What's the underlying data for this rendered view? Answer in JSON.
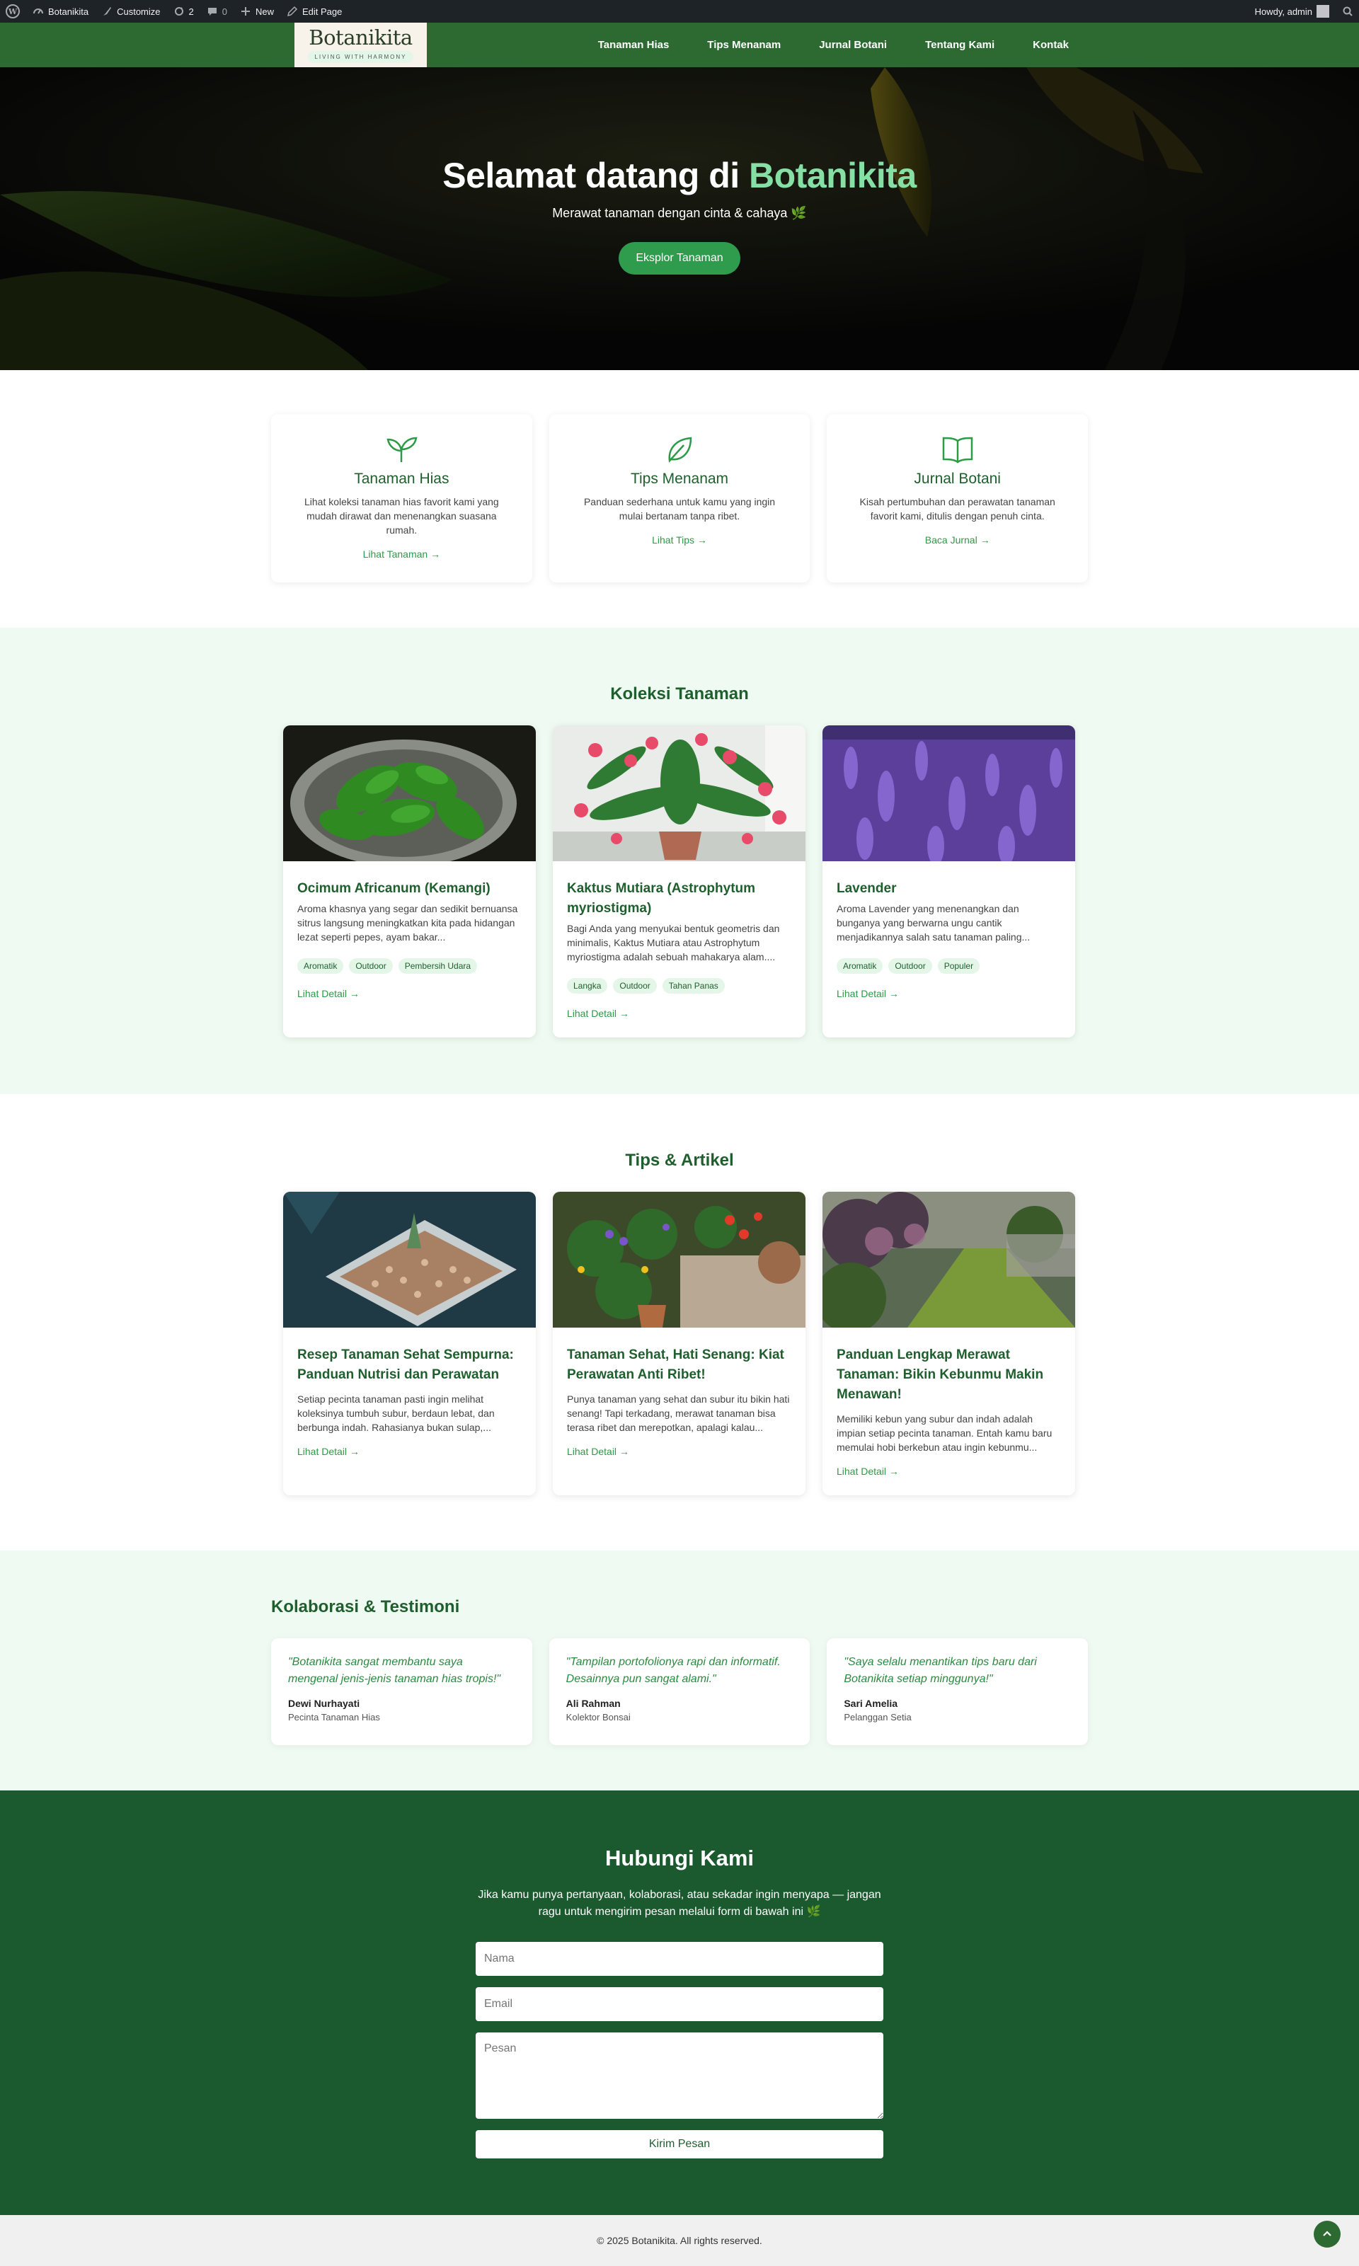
{
  "adminbar": {
    "site_name": "Botanikita",
    "customize": "Customize",
    "updates_count": "2",
    "comments_count": "0",
    "new_label": "New",
    "edit_page": "Edit Page",
    "howdy": "Howdy, admin"
  },
  "header": {
    "logo_name": "Botanikita",
    "logo_tagline": "LIVING WITH HARMONY",
    "nav": [
      "Tanaman Hias",
      "Tips Menanam",
      "Jurnal Botani",
      "Tentang Kami",
      "Kontak"
    ]
  },
  "hero": {
    "title_prefix": "Selamat datang di ",
    "title_accent": "Botanikita",
    "subtitle": "Merawat tanaman dengan cinta & cahaya 🌿",
    "cta": "Eksplor Tanaman"
  },
  "features": [
    {
      "icon": "sprout-icon",
      "title": "Tanaman Hias",
      "text": "Lihat koleksi tanaman hias favorit kami yang mudah dirawat dan menenangkan suasana rumah.",
      "link": "Lihat Tanaman →"
    },
    {
      "icon": "leaf-icon",
      "title": "Tips Menanam",
      "text": "Panduan sederhana untuk kamu yang ingin mulai bertanam tanpa ribet.",
      "link": "Lihat Tips →"
    },
    {
      "icon": "book-icon",
      "title": "Jurnal Botani",
      "text": "Kisah pertumbuhan dan perawatan tanaman favorit kami, ditulis dengan penuh cinta.",
      "link": "Baca Jurnal →"
    }
  ],
  "koleksi": {
    "title": "Koleksi Tanaman",
    "items": [
      {
        "name": "Ocimum Africanum (Kemangi)",
        "desc": "Aroma khasnya yang segar dan sedikit bernuansa sitrus langsung meningkatkan kita pada hidangan lezat seperti pepes, ayam bakar...",
        "tags": [
          "Aromatik",
          "Outdoor",
          "Pembersih Udara"
        ],
        "link": "Lihat Detail →"
      },
      {
        "name": "Kaktus Mutiara (Astrophytum myriostigma)",
        "desc": "Bagi Anda yang menyukai bentuk geometris dan minimalis, Kaktus Mutiara atau Astrophytum myriostigma adalah sebuah mahakarya alam....",
        "tags": [
          "Langka",
          "Outdoor",
          "Tahan Panas"
        ],
        "link": "Lihat Detail →"
      },
      {
        "name": "Lavender",
        "desc": "Aroma Lavender yang menenangkan dan bunganya yang berwarna ungu cantik menjadikannya salah satu tanaman paling...",
        "tags": [
          "Aromatik",
          "Outdoor",
          "Populer"
        ],
        "link": "Lihat Detail →"
      }
    ]
  },
  "tips": {
    "title": "Tips & Artikel",
    "items": [
      {
        "name": "Resep Tanaman Sehat Sempurna: Panduan Nutrisi dan Perawatan",
        "desc": "Setiap pecinta tanaman pasti ingin melihat koleksinya tumbuh subur, berdaun lebat, dan berbunga indah. Rahasianya bukan sulap,...",
        "link": "Lihat Detail →"
      },
      {
        "name": "Tanaman Sehat, Hati Senang: Kiat Perawatan Anti Ribet!",
        "desc": "Punya tanaman yang sehat dan subur itu bikin hati senang! Tapi terkadang, merawat tanaman bisa terasa ribet dan merepotkan, apalagi kalau...",
        "link": "Lihat Detail →"
      },
      {
        "name": "Panduan Lengkap Merawat Tanaman: Bikin Kebunmu Makin Menawan!",
        "desc": "Memiliki kebun yang subur dan indah adalah impian setiap pecinta tanaman. Entah kamu baru memulai hobi berkebun atau ingin kebunmu...",
        "link": "Lihat Detail →"
      }
    ]
  },
  "testimoni": {
    "title": "Kolaborasi & Testimoni",
    "items": [
      {
        "quote": "\"Botanikita sangat membantu saya mengenal jenis-jenis tanaman hias tropis!\"",
        "name": "Dewi Nurhayati",
        "role": "Pecinta Tanaman Hias"
      },
      {
        "quote": "\"Tampilan portofolionya rapi dan informatif. Desainnya pun sangat alami.\"",
        "name": "Ali Rahman",
        "role": "Kolektor Bonsai"
      },
      {
        "quote": "\"Saya selalu menantikan tips baru dari Botanikita setiap minggunya!\"",
        "name": "Sari Amelia",
        "role": "Pelanggan Setia"
      }
    ]
  },
  "contact": {
    "title": "Hubungi Kami",
    "lead": "Jika kamu punya pertanyaan, kolaborasi, atau sekadar ingin menyapa — jangan ragu untuk mengirim pesan melalui form di bawah ini 🌿",
    "name_placeholder": "Nama",
    "email_placeholder": "Email",
    "message_placeholder": "Pesan",
    "submit": "Kirim Pesan"
  },
  "footer": {
    "copyright": "© 2025 Botanikita. All rights reserved."
  },
  "colors": {
    "header_green": "#2d6a31",
    "accent_green": "#2f9b4c",
    "hero_accent": "#86e0a5",
    "light_section": "#effbf2",
    "contact_bg": "#1b5a2e"
  }
}
